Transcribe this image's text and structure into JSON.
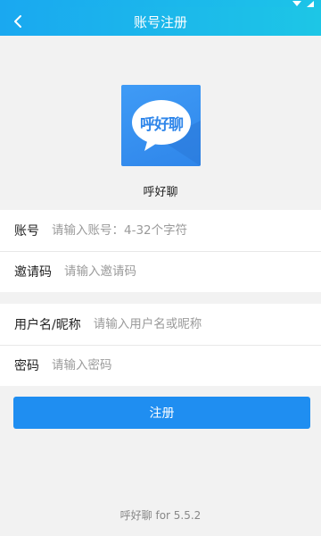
{
  "colors": {
    "header_gradient_start": "#1aa8f0",
    "header_gradient_end": "#1dc6e6",
    "primary_button": "#1f8ef1",
    "background": "#f2f2f2"
  },
  "nav": {
    "back_icon": "chevron-left-icon",
    "title": "账号注册"
  },
  "app": {
    "logo_text": "呼好聊",
    "name": "呼好聊"
  },
  "form": {
    "account": {
      "label": "账号",
      "placeholder": "请输入账号：4-32个字符",
      "value": ""
    },
    "invite": {
      "label": "邀请码",
      "placeholder": "请输入邀请码",
      "value": ""
    },
    "nickname": {
      "label": "用户名/昵称",
      "placeholder": "请输入用户名或昵称",
      "value": ""
    },
    "password": {
      "label": "密码",
      "placeholder": "请输入密码",
      "value": ""
    }
  },
  "register_label": "注册",
  "footer": "呼好聊 for 5.5.2"
}
